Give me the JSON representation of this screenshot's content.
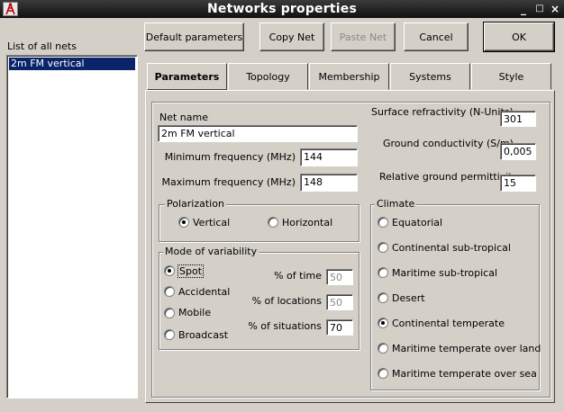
{
  "window": {
    "title": "Networks properties",
    "controls": [
      "_",
      "□",
      "×"
    ]
  },
  "nets": {
    "label": "List of all nets",
    "items": [
      "2m FM vertical"
    ],
    "selected": 0
  },
  "toolbar": {
    "default_parameters": "Default parameters",
    "copy_net": "Copy Net",
    "paste_net": "Paste Net",
    "cancel": "Cancel",
    "ok": "OK"
  },
  "tabs": [
    "Parameters",
    "Topology",
    "Membership",
    "Systems",
    "Style"
  ],
  "active_tab": 0,
  "params": {
    "net_name_label": "Net name",
    "net_name": "2m FM vertical",
    "min_freq_label": "Minimum frequency (MHz)",
    "min_freq": "144",
    "max_freq_label": "Maximum frequency (MHz)",
    "max_freq": "148",
    "surface_refr_label": "Surface refractivity (N-Units)",
    "surface_refr": "301",
    "ground_cond_label": "Ground conductivity (S/m)",
    "ground_cond": "0,005",
    "rel_perm_label": "Relative ground permittivity",
    "rel_perm": "15"
  },
  "polarization": {
    "label": "Polarization",
    "vertical": "Vertical",
    "horizontal": "Horizontal",
    "selected": "vertical"
  },
  "variability": {
    "label": "Mode of variability",
    "options": [
      "Spot",
      "Accidental",
      "Mobile",
      "Broadcast"
    ],
    "selected": 0,
    "time_label": "% of time",
    "time": "50",
    "locations_label": "% of locations",
    "locations": "50",
    "situations_label": "% of situations",
    "situations": "70"
  },
  "climate": {
    "label": "Climate",
    "options": [
      "Equatorial",
      "Continental sub-tropical",
      "Maritime sub-tropical",
      "Desert",
      "Continental temperate",
      "Maritime temperate over land",
      "Maritime temperate over sea"
    ],
    "selected": 4
  },
  "colors": {
    "selection": "#0a246a",
    "face": "#d4d0c8"
  }
}
